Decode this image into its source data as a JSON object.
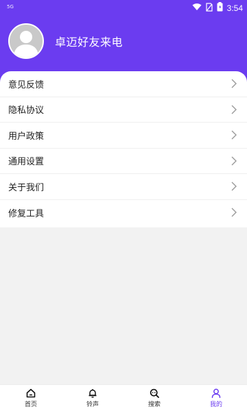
{
  "status_bar": {
    "network": "5G",
    "time": "3:54"
  },
  "profile": {
    "app_name": "卓迈好友来电"
  },
  "menu": [
    {
      "label": "意见反馈"
    },
    {
      "label": "隐私协议"
    },
    {
      "label": "用户政策"
    },
    {
      "label": "通用设置"
    },
    {
      "label": "关于我们"
    },
    {
      "label": "修复工具"
    }
  ],
  "tabs": [
    {
      "label": "首页",
      "icon": "home-icon"
    },
    {
      "label": "铃声",
      "icon": "bell-icon"
    },
    {
      "label": "搜索",
      "icon": "search-icon"
    },
    {
      "label": "我的",
      "icon": "user-icon",
      "active": true
    }
  ],
  "colors": {
    "brand": "#6b3cf0",
    "background": "#f2f2f2",
    "card": "#ffffff"
  }
}
